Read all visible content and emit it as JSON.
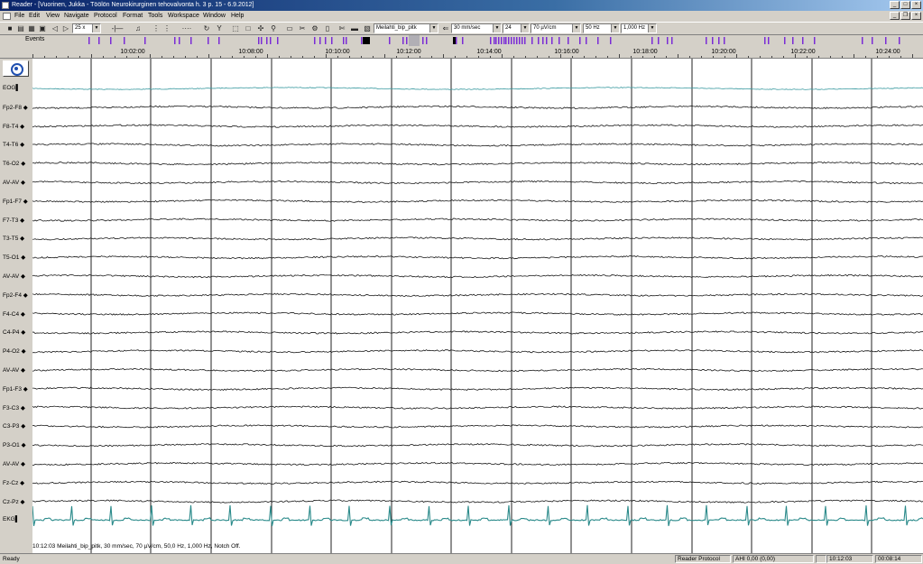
{
  "window": {
    "title": "Reader - [Vuorinen, Jukka - Töölön Neurokirurginen tehovalvonta h. 3 p. 15 - 6.9.2012]"
  },
  "menu": [
    "File",
    "Edit",
    "View",
    "Navigate",
    "Protocol",
    "Format",
    "Tools",
    "Workspace",
    "Window",
    "Help"
  ],
  "toolbar": {
    "page_zoom": "25 x",
    "montage": "Meilahti_bip_pitk",
    "speed": "30 mm/sec",
    "channels": "24",
    "sensitivity": "70 µV/cm",
    "lowpass": "50 Hz",
    "highpass": "1,000 Hz"
  },
  "events": {
    "label": "Events",
    "marker_color": "#7a2bd6",
    "selected_color": "#000000"
  },
  "timeline": {
    "labels": [
      "10:02:00",
      "10:08:00",
      "10:10:00",
      "10:12:00",
      "10:14:00",
      "10:16:00",
      "10:18:00",
      "10:20:00",
      "10:22:00",
      "10:24:00"
    ]
  },
  "channels": [
    "EOG",
    "Fp2-F8",
    "F8-T4",
    "T4-T6",
    "T6-O2",
    "AV-AV",
    "Fp1-F7",
    "F7-T3",
    "T3-T5",
    "T5-O1",
    "AV-AV",
    "Fp2-F4",
    "F4-C4",
    "C4-P4",
    "P4-O2",
    "AV-AV",
    "Fp1-F3",
    "F3-C3",
    "C3-P3",
    "P3-O1",
    "AV-AV",
    "Fz-Cz",
    "Cz-Pz",
    "EKG"
  ],
  "trace_colors": {
    "eeg": "#1a1a1a",
    "eog": "#3a9aa0",
    "ekg": "#2a8a8a"
  },
  "info_line": "10:12:03 Meilahti_bip_pitk, 30 mm/sec, 70 µV/cm, 50,0 Hz, 1,000 Hz, Notch Off.",
  "status": {
    "ready": "Ready",
    "protocol": "Reader Protocol",
    "ahi": "AHI 0,00 (0,00)",
    "time": "10:12:03",
    "elapsed": "00:08:14"
  }
}
